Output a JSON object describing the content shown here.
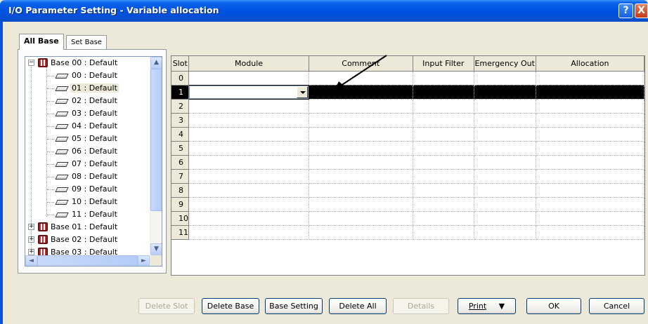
{
  "window": {
    "title": "I/O Parameter Setting - Variable allocation",
    "help_label": "?",
    "close_label": "X"
  },
  "tabs": [
    {
      "label": "All Base",
      "active": true
    },
    {
      "label": "Set Base",
      "active": false
    }
  ],
  "tree": {
    "base00": {
      "label": "Base 00 : Default",
      "expanded": true
    },
    "slots": [
      "00 : Default",
      "01 : Default",
      "02 : Default",
      "03 : Default",
      "04 : Default",
      "05 : Default",
      "06 : Default",
      "07 : Default",
      "08 : Default",
      "09 : Default",
      "10 : Default",
      "11 : Default"
    ],
    "selected_slot": "01 : Default",
    "bases": [
      "Base 01 : Default",
      "Base 02 : Default",
      "Base 03 : Default"
    ]
  },
  "grid": {
    "columns": [
      "Slot",
      "Module",
      "Comment",
      "Input Filter",
      "Emergency Out",
      "Allocation"
    ],
    "rows": [
      "0",
      "1",
      "2",
      "3",
      "4",
      "5",
      "6",
      "7",
      "8",
      "9",
      "10",
      "11"
    ],
    "selected_row": "1",
    "module_value": ""
  },
  "buttons": {
    "delete_slot": "Delete Slot",
    "delete_base": "Delete Base",
    "base_setting": "Base Setting",
    "delete_all": "Delete All",
    "details": "Details",
    "print": "Print",
    "ok": "OK",
    "cancel": "Cancel"
  },
  "colors": {
    "titlebar": "#0054e3",
    "selection": "#000000",
    "dialog_bg": "#ece9d8"
  }
}
